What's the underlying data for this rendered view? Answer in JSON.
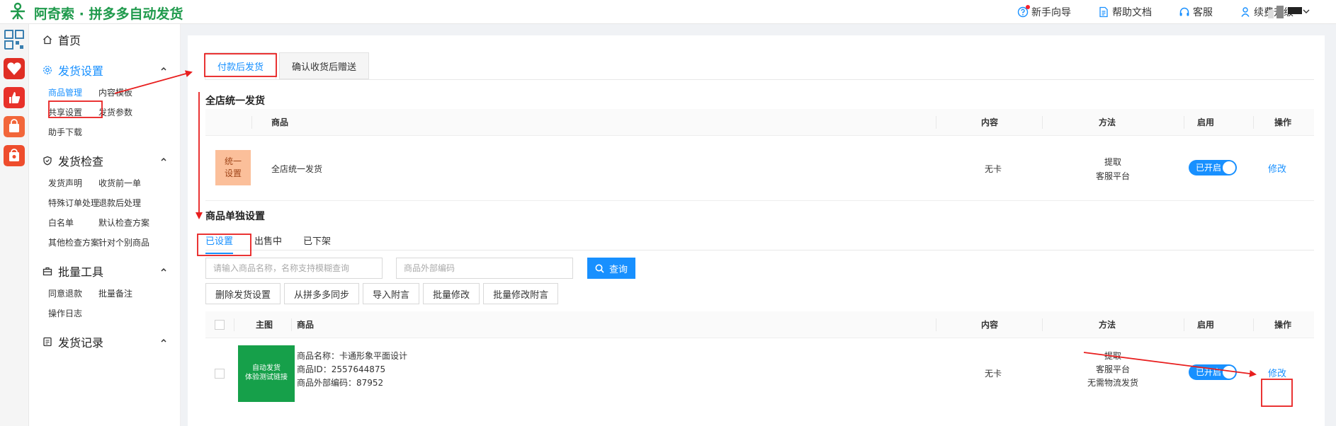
{
  "app": {
    "brand": "阿奇索 · 拼多多自动发货"
  },
  "topnav": [
    {
      "label": "新手向导",
      "icon": "question-icon"
    },
    {
      "label": "帮助文档",
      "icon": "document-icon"
    },
    {
      "label": "客服",
      "icon": "headset-icon"
    },
    {
      "label": "续费升级",
      "icon": "crown-icon"
    }
  ],
  "sidebar": {
    "home": "首页",
    "ship_settings": {
      "title": "发货设置",
      "items": [
        "商品管理",
        "内容模板",
        "共享设置",
        "发货参数",
        "助手下载"
      ]
    },
    "ship_check": {
      "title": "发货检查",
      "items": [
        "发货声明",
        "收货前一单",
        "特殊订单处理",
        "退款后处理",
        "白名单",
        "默认检查方案",
        "其他检查方案",
        "针对个别商品"
      ]
    },
    "bulk_tools": {
      "title": "批量工具",
      "items": [
        "同意退款",
        "批量备注",
        "操作日志"
      ]
    },
    "ship_records": {
      "title": "发货记录"
    }
  },
  "tabs": [
    "付款后发货",
    "确认收货后赠送"
  ],
  "unified": {
    "title": "全店统一发货",
    "headers": {
      "product": "商品",
      "content": "内容",
      "method": "方法",
      "enabled": "启用",
      "action": "操作"
    },
    "row": {
      "badge_line1": "统一",
      "badge_line2": "设置",
      "name": "全店统一发货",
      "content": "无卡",
      "method_line1": "提取",
      "method_line2": "客服平台",
      "switch": "已开启",
      "action": "修改"
    }
  },
  "single": {
    "title": "商品单独设置",
    "subtabs": [
      "已设置",
      "出售中",
      "已下架"
    ],
    "search": {
      "name_placeholder": "请输入商品名称，名称支持模糊查询",
      "code_placeholder": "商品外部编码",
      "button": "查询"
    },
    "buttons": [
      "删除发货设置",
      "从拼多多同步",
      "导入附言",
      "批量修改",
      "批量修改附言"
    ],
    "headers": {
      "image": "主图",
      "product": "商品",
      "content": "内容",
      "method": "方法",
      "enabled": "启用",
      "action": "操作"
    },
    "row": {
      "image_line1": "自动发货",
      "image_line2": "体验测试链接",
      "name": "商品名称：卡通形象平面设计",
      "id": "商品ID：2557644875",
      "code": "商品外部编码：87952",
      "content": "无卡",
      "method_line1": "提取",
      "method_line2": "客服平台",
      "method_line3": "无需物流发货",
      "switch": "已开启",
      "action": "修改"
    }
  },
  "colors": {
    "primary": "#1890ff",
    "brand": "#1f9a4c",
    "annotation": "#e81e1e"
  }
}
